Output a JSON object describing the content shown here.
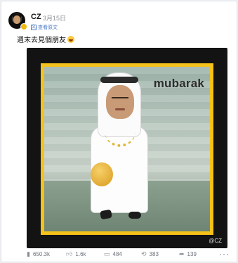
{
  "post": {
    "author": "CZ",
    "date": "3月15日",
    "translate_label": "查看原文",
    "text": "週末去見個朋友",
    "media": {
      "logo": "mubarak",
      "watermark": "@CZ"
    },
    "actions": {
      "views": "650.3k",
      "likes": "1.6k",
      "comments": "484",
      "reposts": "383",
      "shares": "139",
      "more": "···"
    }
  },
  "colors": {
    "accent": "#f4c21a",
    "verified_badge": "#f0b90b",
    "link": "#4a79c2"
  },
  "icons": {
    "views": "bar-chart-icon",
    "likes": "thumbs-up-icon",
    "comments": "comment-icon",
    "reposts": "repost-icon",
    "shares": "share-icon"
  }
}
